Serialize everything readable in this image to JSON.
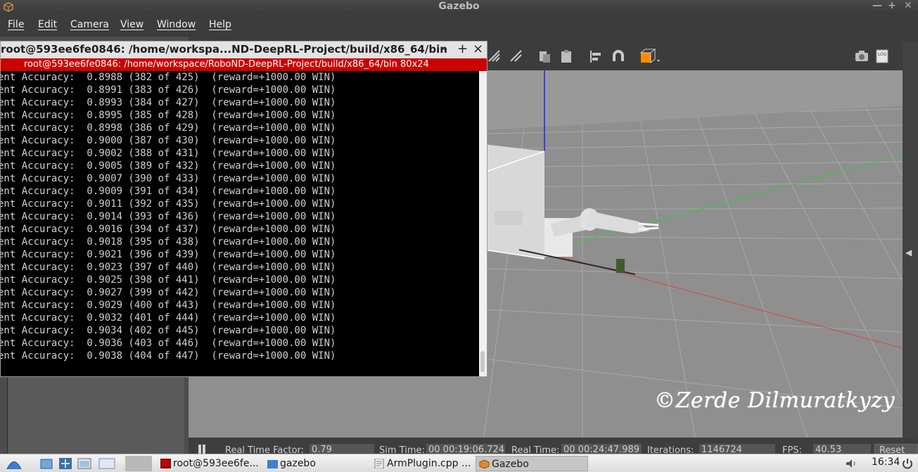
{
  "app_window": {
    "title": "Gazebo",
    "menu": [
      "File",
      "Edit",
      "Camera",
      "View",
      "Window",
      "Help"
    ]
  },
  "terminal": {
    "title": "root@593ee6fe0846: /home/workspa...ND-DeepRL-Project/build/x86_64/bin",
    "tab_label": "root@593ee6fe0846: /home/workspace/RoboND-DeepRL-Project/build/x86_64/bin 80x24",
    "lines": [
      "ent Accuracy:  0.8988 (382 of 425)  (reward=+1000.00 WIN)",
      "ent Accuracy:  0.8991 (383 of 426)  (reward=+1000.00 WIN)",
      "ent Accuracy:  0.8993 (384 of 427)  (reward=+1000.00 WIN)",
      "ent Accuracy:  0.8995 (385 of 428)  (reward=+1000.00 WIN)",
      "ent Accuracy:  0.8998 (386 of 429)  (reward=+1000.00 WIN)",
      "ent Accuracy:  0.9000 (387 of 430)  (reward=+1000.00 WIN)",
      "ent Accuracy:  0.9002 (388 of 431)  (reward=+1000.00 WIN)",
      "ent Accuracy:  0.9005 (389 of 432)  (reward=+1000.00 WIN)",
      "ent Accuracy:  0.9007 (390 of 433)  (reward=+1000.00 WIN)",
      "ent Accuracy:  0.9009 (391 of 434)  (reward=+1000.00 WIN)",
      "ent Accuracy:  0.9011 (392 of 435)  (reward=+1000.00 WIN)",
      "ent Accuracy:  0.9014 (393 of 436)  (reward=+1000.00 WIN)",
      "ent Accuracy:  0.9016 (394 of 437)  (reward=+1000.00 WIN)",
      "ent Accuracy:  0.9018 (395 of 438)  (reward=+1000.00 WIN)",
      "ent Accuracy:  0.9021 (396 of 439)  (reward=+1000.00 WIN)",
      "ent Accuracy:  0.9023 (397 of 440)  (reward=+1000.00 WIN)",
      "ent Accuracy:  0.9025 (398 of 441)  (reward=+1000.00 WIN)",
      "ent Accuracy:  0.9027 (399 of 442)  (reward=+1000.00 WIN)",
      "ent Accuracy:  0.9029 (400 of 443)  (reward=+1000.00 WIN)",
      "ent Accuracy:  0.9032 (401 of 444)  (reward=+1000.00 WIN)",
      "ent Accuracy:  0.9034 (402 of 445)  (reward=+1000.00 WIN)",
      "ent Accuracy:  0.9036 (403 of 446)  (reward=+1000.00 WIN)",
      "ent Accuracy:  0.9038 (404 of 447)  (reward=+1000.00 WIN)"
    ]
  },
  "watermark": "©Zerde Dilmuratkyzy",
  "status": {
    "real_time_factor_label": "Real Time Factor:",
    "real_time_factor": "0.79",
    "sim_time_label": "Sim Time:",
    "sim_time": "00 00:19:06.724",
    "real_time_label": "Real Time:",
    "real_time": "00 00:24:47.989",
    "iterations_label": "Iterations:",
    "iterations": "1146724",
    "fps_label": "FPS:",
    "fps": "40.53",
    "reset_label": "Reset"
  },
  "taskbar": {
    "tasks": [
      "root@593ee6fe...",
      "gazebo",
      "ArmPlugin.cpp ...",
      "Gazebo"
    ],
    "clock": "16:34"
  },
  "colors": {
    "terminal_tab": "#cc0000",
    "viewport": "#8f8f8f",
    "axis_x": "#ff2020",
    "axis_y": "#33cc33",
    "axis_z": "#2020ff",
    "toolbar_accent": "#ff8c00"
  }
}
